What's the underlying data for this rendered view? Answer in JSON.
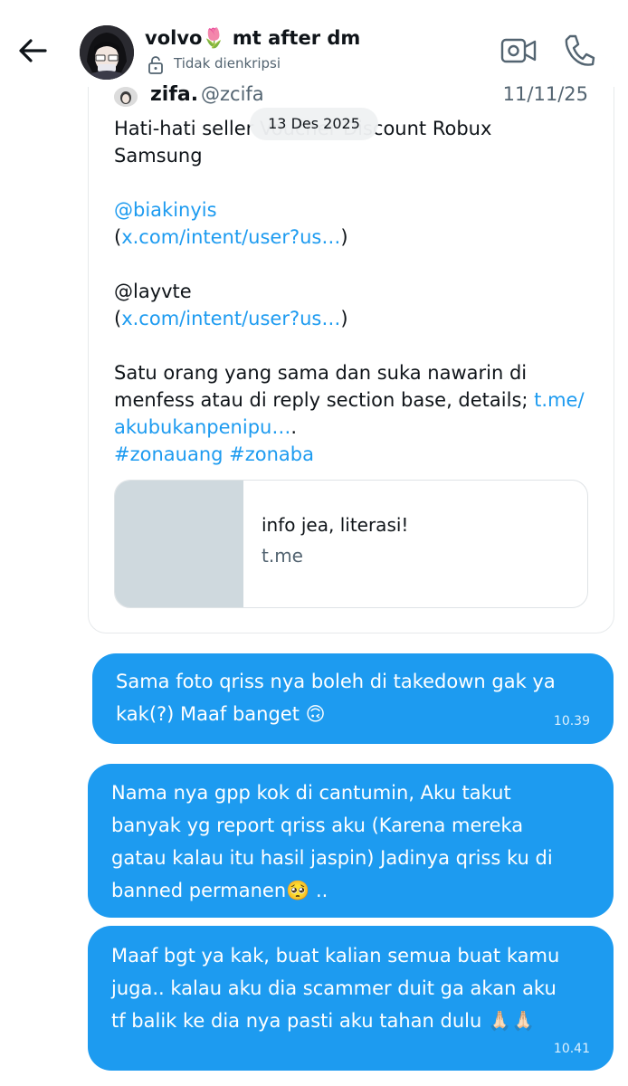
{
  "header": {
    "contact_name": "volvo🌷 mt after dm",
    "encryption_status": "Tidak dienkripsi"
  },
  "date_separator": "13 Des 2025",
  "shared_tweet": {
    "author_name": "zifa.",
    "author_handle": "@zcifa",
    "date": "11/11/25",
    "line1": "Hati-hati seller Voucher Discount Robux",
    "line2": "Samsung",
    "mention1": "@biakinyis",
    "mention1_link_open": "(",
    "mention1_link": "x.com/intent/user?us…",
    "mention1_link_close": ")",
    "mention2": "@layvte",
    "mention2_link_open": "(",
    "mention2_link": "x.com/intent/user?us…",
    "mention2_link_close": ")",
    "body1": "Satu orang yang sama dan suka nawarin di",
    "body2_text": "menfess atau di reply section base, details; ",
    "body2_link": "t.me/",
    "body3_link": "akubukanpenipu…",
    "body3_suffix": ".",
    "hashtags": "#zonauang #zonaba",
    "link_card": {
      "title": "info jea, literasi!",
      "domain": "t.me"
    }
  },
  "messages": [
    {
      "lines": [
        "Sama foto qriss nya boleh di takedown gak ya",
        "kak(?) Maaf banget 🙃"
      ],
      "time": "10.39"
    },
    {
      "lines": [
        "Nama nya gpp kok di cantumin, Aku takut",
        "banyak yg report qriss aku (Karena mereka",
        "gatau kalau itu hasil jaspin)  Jadinya qriss ku di",
        "banned permanen🥺 .."
      ],
      "time": ""
    },
    {
      "lines": [
        "Maaf bgt ya kak, buat kalian semua buat kamu",
        "juga.. kalau aku dia scammer duit ga akan aku",
        "tf balik ke dia nya pasti aku tahan dulu 🙏🏻🙏🏻"
      ],
      "time": "10.41"
    }
  ],
  "colors": {
    "bubble": "#1d9bf0",
    "link": "#1d9bf0",
    "secondary_text": "#536471"
  }
}
